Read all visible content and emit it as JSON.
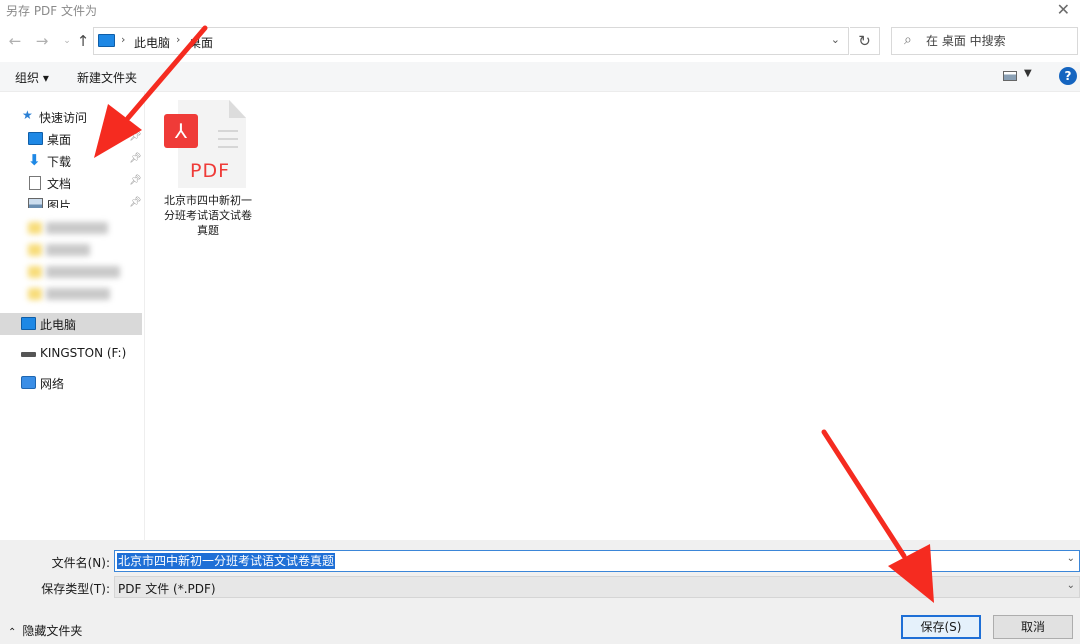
{
  "window": {
    "title": "另存 PDF 文件为"
  },
  "address": {
    "crumbs": [
      "此电脑",
      "桌面"
    ]
  },
  "search": {
    "placeholder": "在 桌面 中搜索"
  },
  "toolbar": {
    "organize": "组织 ▾",
    "new_folder": "新建文件夹",
    "help": "?"
  },
  "nav": {
    "quick_access": "快速访问",
    "desktop": "桌面",
    "downloads": "下载",
    "documents": "文档",
    "pictures": "图片",
    "this_pc": "此电脑",
    "kingston": "KINGSTON (F:)",
    "network": "网络"
  },
  "file": {
    "name": "北京市四中新初一分班考试语文试卷真题",
    "badge": "PDF"
  },
  "form": {
    "filename_label": "文件名(N):",
    "filename_value": "北京市四中新初一分班考试语文试卷真题",
    "filetype_label": "保存类型(T):",
    "filetype_value": "PDF 文件 (*.PDF)",
    "hide_folders": "隐藏文件夹",
    "save": "保存(S)",
    "cancel": "取消"
  },
  "colors": {
    "accent": "#1e6fd6",
    "pdf_red": "#ef3b38",
    "annotation_red": "#f52b20"
  }
}
